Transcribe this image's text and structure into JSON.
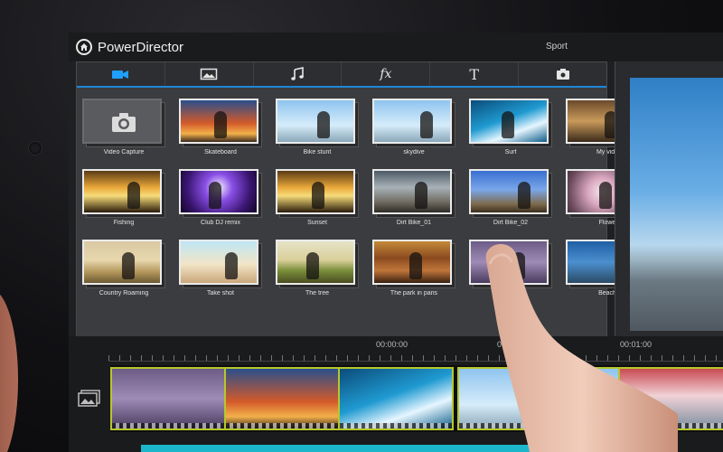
{
  "app": {
    "title": "PowerDirector",
    "project": "Sport"
  },
  "library": {
    "tabs": [
      {
        "icon": "video-camera-icon",
        "active": true
      },
      {
        "icon": "photo-icon",
        "active": false
      },
      {
        "icon": "music-note-icon",
        "active": false
      },
      {
        "icon": "fx-icon",
        "label": "fx",
        "active": false
      },
      {
        "icon": "title-text-icon",
        "label": "T",
        "active": false
      },
      {
        "icon": "camera-bag-icon",
        "active": false
      }
    ],
    "items": [
      {
        "label": "Video Capture",
        "palette": "capture"
      },
      {
        "label": "Skateboard",
        "palette": "p-sky"
      },
      {
        "label": "Bike stunt",
        "palette": "p-blue"
      },
      {
        "label": "skydive",
        "palette": "p-blue"
      },
      {
        "label": "Surf",
        "palette": "p-wave"
      },
      {
        "label": "My vide",
        "palette": "p-people"
      },
      {
        "label": "Fishing",
        "palette": "p-sunset"
      },
      {
        "label": "Club DJ remix",
        "palette": "p-party"
      },
      {
        "label": "Sunset",
        "palette": "p-sunset"
      },
      {
        "label": "Dirt Bike_01",
        "palette": "p-dust"
      },
      {
        "label": "Dirt Bike_02",
        "palette": "p-moto"
      },
      {
        "label": "Flowe",
        "palette": "p-flower"
      },
      {
        "label": "Country Roaming",
        "palette": "p-field"
      },
      {
        "label": "Take shot",
        "palette": "p-beach"
      },
      {
        "label": "The tree",
        "palette": "p-tree"
      },
      {
        "label": "The park in paris",
        "palette": "p-park"
      },
      {
        "label": "",
        "palette": "p-purple"
      },
      {
        "label": "Beach",
        "palette": "p-coast"
      }
    ]
  },
  "timeline": {
    "ticks": [
      "00:00:00",
      "00:00:",
      "00:01:00"
    ]
  }
}
